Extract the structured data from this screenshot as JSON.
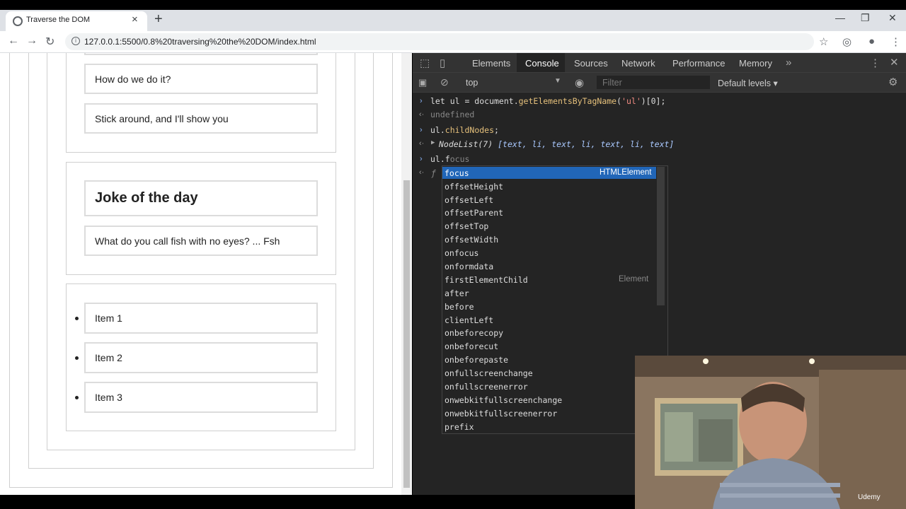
{
  "browser": {
    "tab_title": "Traverse the DOM",
    "url": "127.0.0.1:5500/0.8%20traversing%20the%20DOM/index.html"
  },
  "page": {
    "card1": [
      "How do we do it?",
      "Stick around, and I'll show you"
    ],
    "joke_title": "Joke of the day",
    "joke_text": "What do you call fish with no eyes? ... Fsh",
    "list": [
      "Item 1",
      "Item 2",
      "Item 3"
    ]
  },
  "devtools": {
    "tabs": [
      "Elements",
      "Console",
      "Sources",
      "Network",
      "Performance",
      "Memory"
    ],
    "active_tab": "Console",
    "context": "top",
    "filter_placeholder": "Filter",
    "levels": "Default levels ▾",
    "console": {
      "line1": {
        "a": "let ul = document.",
        "fn": "getElementsByTagName",
        "b": "(",
        "str": "'ul'",
        "c": ")[0];"
      },
      "line2": "undefined",
      "line3": {
        "a": "ul.",
        "fn": "childNodes",
        "b": ";"
      },
      "line4": {
        "a": "NodeList(7) ",
        "b": "[text, li, text, li, text, li, text]"
      },
      "line5": {
        "a": "ul.",
        "typed": "f",
        "ghost": "ocus"
      }
    },
    "autocomplete": {
      "items": [
        "focus",
        "offsetHeight",
        "offsetLeft",
        "offsetParent",
        "offsetTop",
        "offsetWidth",
        "onfocus",
        "onformdata",
        "firstElementChild",
        "after",
        "before",
        "clientLeft",
        "onbeforecopy",
        "onbeforecut",
        "onbeforepaste",
        "onfullscreenchange",
        "onfullscreenerror",
        "onwebkitfullscreenchange",
        "onwebkitfullscreenerror",
        "prefix"
      ],
      "focus_type": "HTMLElement",
      "first_element_type": "Element"
    }
  },
  "watermark": "Udemy"
}
